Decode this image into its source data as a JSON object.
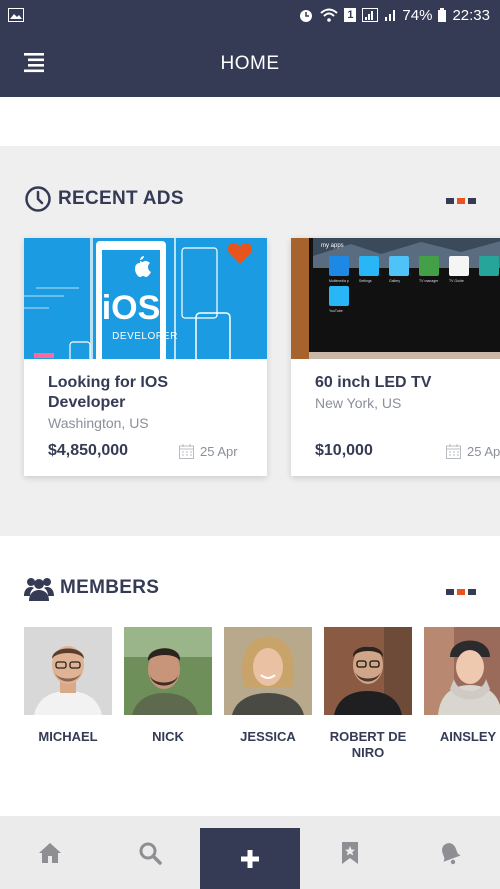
{
  "status_bar": {
    "battery": "74%",
    "time": "22:33",
    "sim_slot": "1"
  },
  "app_bar": {
    "title": "HOME"
  },
  "recent_ads": {
    "title": "RECENT ADS",
    "cards": [
      {
        "title": "Looking for IOS Developer",
        "location": "Washington, US",
        "price": "$4,850,000",
        "date": "25 Apr",
        "image_text": "iOS",
        "image_subtext": "DEVELOPER"
      },
      {
        "title": "60 inch LED TV",
        "location": "New York, US",
        "price": "$10,000",
        "date": "25 Ap",
        "image_text": "my apps",
        "app_labels": [
          "Multimedia p",
          "Settings",
          "Gallery",
          "TV manager",
          "TV Guide",
          "YouTube"
        ]
      }
    ]
  },
  "members": {
    "title": "MEMBERS",
    "people": [
      {
        "name": "MICHAEL"
      },
      {
        "name": "NICK"
      },
      {
        "name": "JESSICA"
      },
      {
        "name": "ROBERT DE NIRO"
      },
      {
        "name": "AINSLEY"
      }
    ]
  },
  "bottom_nav": {
    "items": [
      "home-icon",
      "search-icon",
      "plus-icon",
      "bookmark-icon",
      "bell-icon"
    ]
  },
  "colors": {
    "primary": "#353b55",
    "accent": "#e8541e",
    "background": "#efefef"
  }
}
